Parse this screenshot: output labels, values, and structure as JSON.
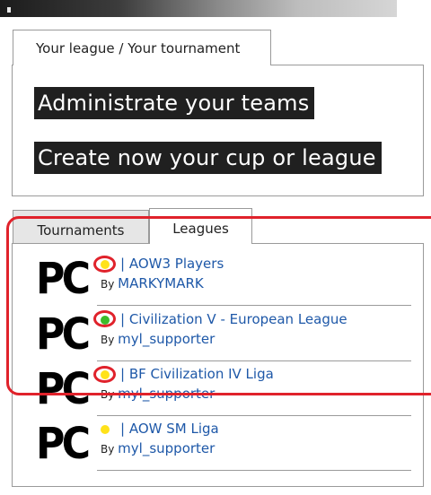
{
  "league_tournament": {
    "tab_label": "Your league / Your tournament",
    "administrate_label": "Administrate your teams",
    "create_label": "Create now your cup or league"
  },
  "tabs": [
    {
      "label": "Tournaments",
      "active": false
    },
    {
      "label": "Leagues",
      "active": true
    }
  ],
  "leagues": [
    {
      "logo": "PC",
      "status_color": "#ffe21a",
      "title": "| AOW3 Players",
      "by": "By",
      "user": "MARKYMARK"
    },
    {
      "logo": "PC",
      "status_color": "#3dbb2a",
      "title": "| Civilization V - European League",
      "by": "By",
      "user": "myl_supporter"
    },
    {
      "logo": "PC",
      "status_color": "#ffe21a",
      "title": "| BF Civilization IV Liga",
      "by": "By",
      "user": "myl_supporter"
    },
    {
      "logo": "PC",
      "status_color": "#ffe21a",
      "title": "| AOW SM Liga",
      "by": "By",
      "user": "myl_supporter"
    }
  ],
  "annotation_color": "#e0222b"
}
